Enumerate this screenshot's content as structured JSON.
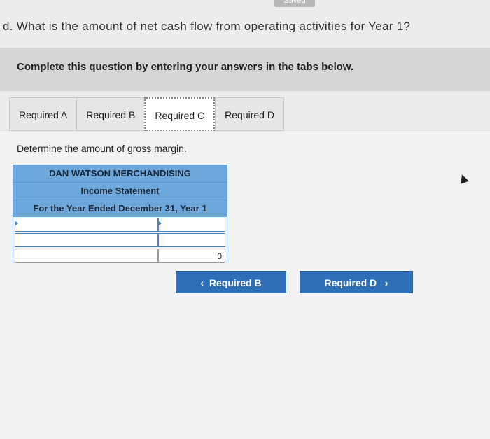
{
  "header": {
    "saved_label": "Saved",
    "cut_question": "d. What is the amount of net cash flow from operating activities for Year 1?"
  },
  "instruction": "Complete this question by entering your answers in the tabs below.",
  "tabs": [
    {
      "label": "Required A",
      "active": false
    },
    {
      "label": "Required B",
      "active": false
    },
    {
      "label": "Required C",
      "active": true
    },
    {
      "label": "Required D",
      "active": false
    }
  ],
  "panel": {
    "prompt": "Determine the amount of gross margin.",
    "statement": {
      "company": "DAN WATSON MERCHANDISING",
      "title": "Income Statement",
      "period": "For the Year Ended December 31, Year 1",
      "rows": [
        {
          "label": "",
          "value": ""
        },
        {
          "label": "",
          "value": ""
        }
      ],
      "total_value": "0"
    }
  },
  "nav": {
    "prev_label": "Required B",
    "prev_chevron": "‹",
    "next_label": "Required D",
    "next_chevron": "›"
  },
  "colors": {
    "accent_button": "#2f6fb7",
    "table_header": "#6ea7dc"
  }
}
